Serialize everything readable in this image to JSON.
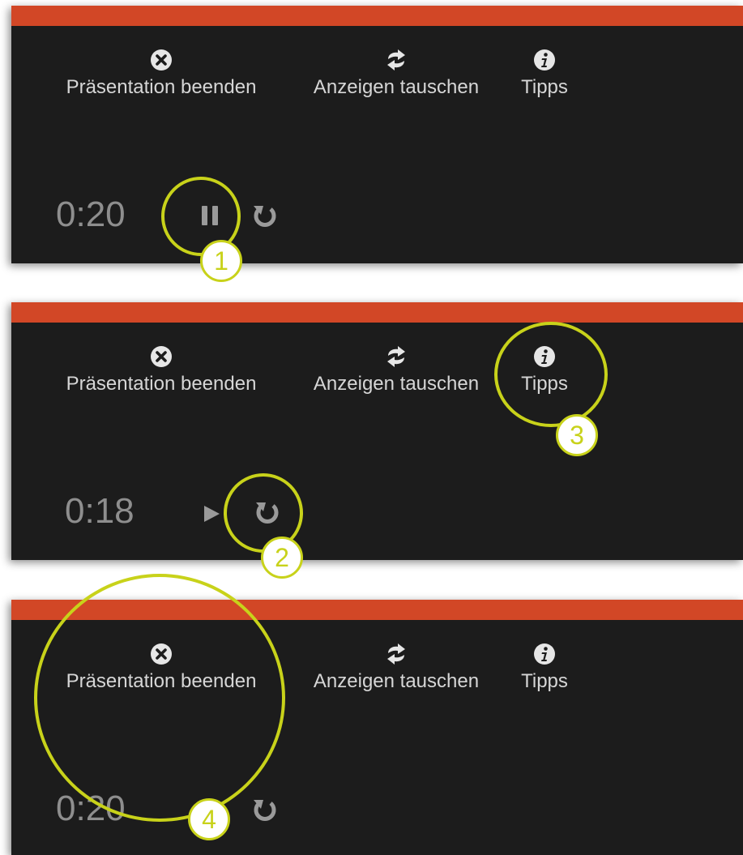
{
  "colors": {
    "accent_bar": "#d24726",
    "panel_bg": "#1c1c1c",
    "toolbar_text": "#d6d6d6",
    "timer_text": "#8e8e8e",
    "callout": "#c8d21a"
  },
  "toolbar": {
    "end_presentation": {
      "label": "Präsentation beenden",
      "icon": "close-circle-icon"
    },
    "swap_displays": {
      "label": "Anzeigen tauschen",
      "icon": "swap-arrows-icon"
    },
    "tips": {
      "label": "Tipps",
      "icon": "info-icon"
    }
  },
  "panels": [
    {
      "timer": "0:20",
      "control": "pause-icon",
      "reset": "reset-icon"
    },
    {
      "timer": "0:18",
      "control": "play-icon",
      "reset": "reset-icon"
    },
    {
      "timer": "0:20",
      "control": "pause-icon",
      "reset": "reset-icon"
    }
  ],
  "callouts": [
    {
      "number": "1",
      "target": "pause-button"
    },
    {
      "number": "2",
      "target": "reset-button"
    },
    {
      "number": "3",
      "target": "tips-button"
    },
    {
      "number": "4",
      "target": "end-presentation-button"
    }
  ]
}
